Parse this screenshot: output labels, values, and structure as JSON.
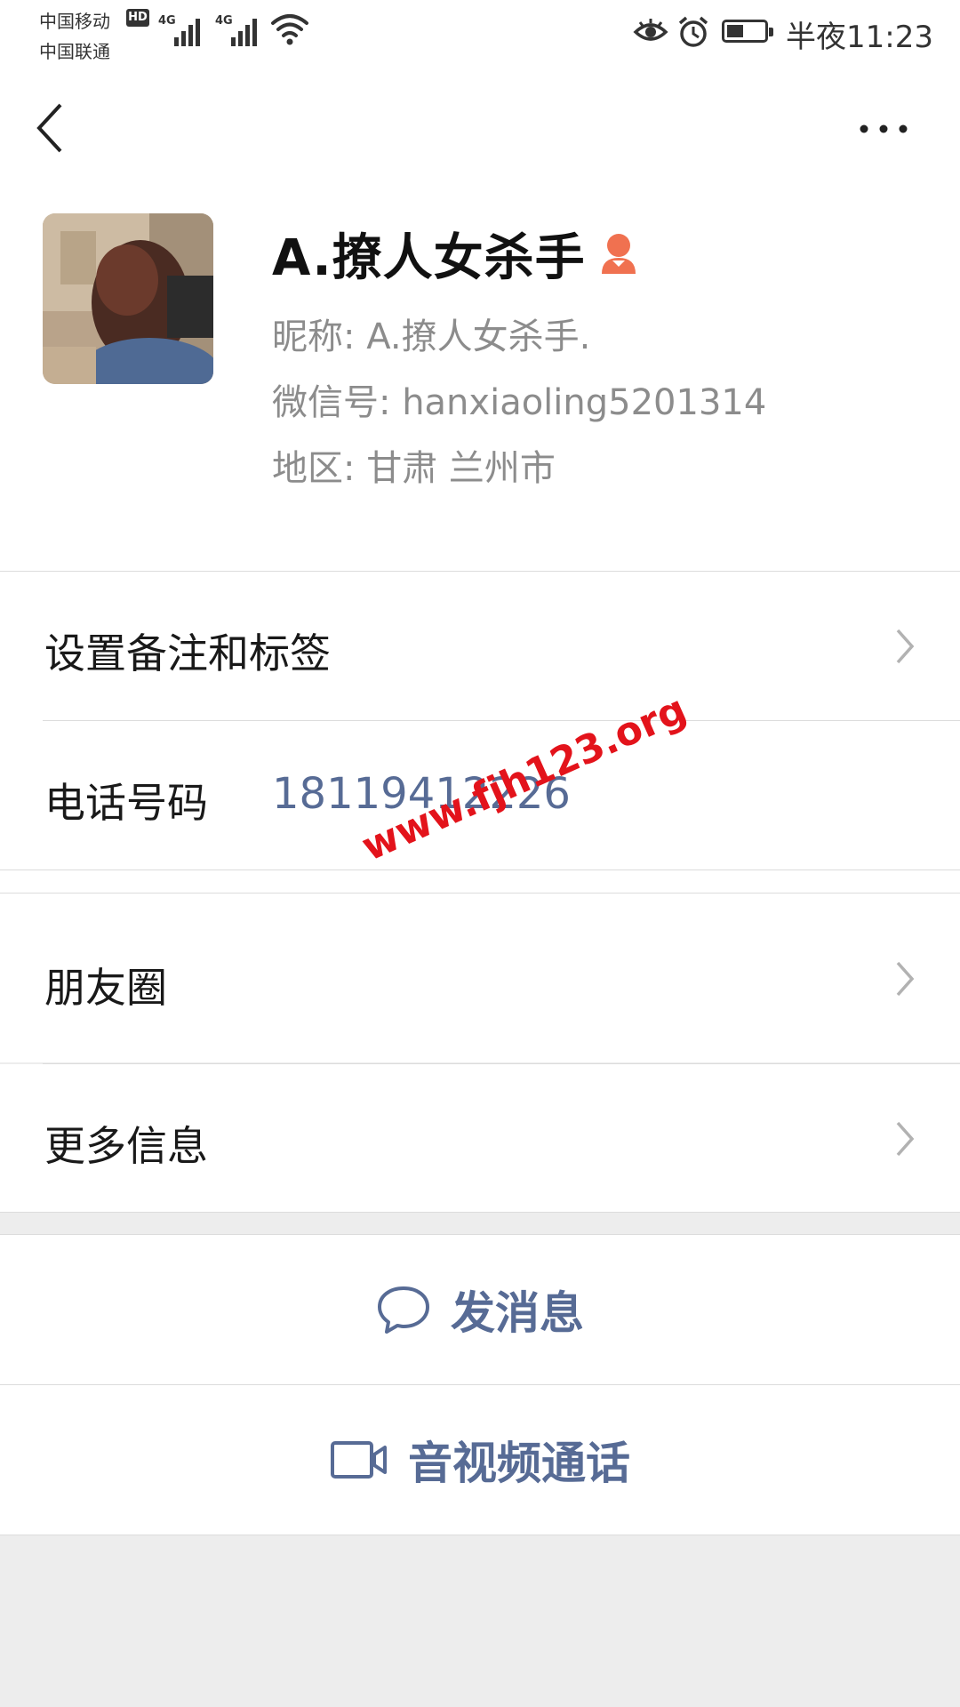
{
  "status_bar": {
    "carrier_1": "中国移动",
    "carrier_2": "中国联通",
    "hd_badge": "HD",
    "network_1": "4G",
    "network_2": "4G",
    "time": "半夜11:23",
    "icons": [
      "signal-icon",
      "wifi-icon",
      "eye-icon",
      "alarm-icon",
      "battery-icon"
    ]
  },
  "nav": {
    "back_icon": "back-chevron-icon",
    "more_icon": "more-dots-icon"
  },
  "profile": {
    "name": "A.撩人女杀手",
    "gender_icon": "female-icon",
    "nickname": "昵称:  A.撩人女杀手.",
    "wechat_id": "微信号:  hanxiaoling5201314",
    "region": "地区:  甘肃  兰州市"
  },
  "cells": {
    "remark_tags": "设置备注和标签",
    "phone_label": "电话号码",
    "phone_value": "18119412226",
    "moments": "朋友圈",
    "more_info": "更多信息"
  },
  "watermark": "www.fjh123.org",
  "actions": {
    "send_message": "发消息",
    "av_call": "音视频通话"
  },
  "colors": {
    "link_blue": "#576b95",
    "gender_orange": "#f07150",
    "watermark_red": "#e3131b",
    "background_gray": "#ededed"
  }
}
